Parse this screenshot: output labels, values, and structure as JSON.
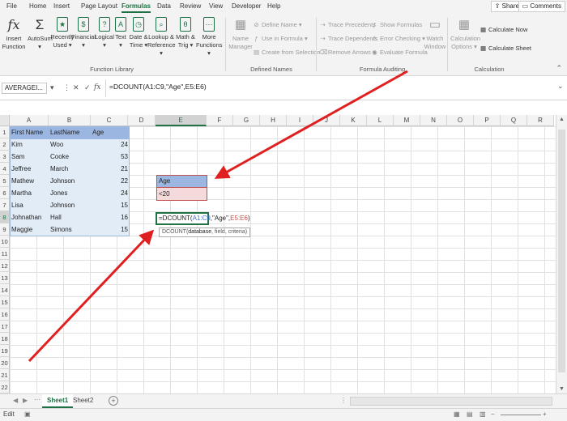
{
  "menu": [
    "File",
    "Home",
    "Insert",
    "Page Layout",
    "Formulas",
    "Data",
    "Review",
    "View",
    "Developer",
    "Help"
  ],
  "share_label": "Share",
  "comments_label": "Comments",
  "ribbon": {
    "insert_function": [
      "Insert",
      "Function"
    ],
    "autosum": [
      "AutoSum",
      "▾"
    ],
    "recently_used": [
      "Recently",
      "Used ▾"
    ],
    "financial": [
      "Financial",
      "▾"
    ],
    "logical": [
      "Logical",
      "▾"
    ],
    "text": [
      "Text",
      "▾"
    ],
    "date_time": [
      "Date &",
      "Time ▾"
    ],
    "lookup_reference": [
      "Lookup &",
      "Reference ▾"
    ],
    "math_trig": [
      "Math &",
      "Trig ▾"
    ],
    "more_functions": [
      "More",
      "Functions ▾"
    ],
    "name_manager": [
      "Name",
      "Manager"
    ],
    "define_name": "Define Name",
    "use_in_formula": "Use in Formula",
    "create_from_selection": "Create from Selection",
    "trace_precedents": "Trace Precedents",
    "trace_dependents": "Trace Dependents",
    "remove_arrows": "Remove Arrows",
    "show_formulas": "Show Formulas",
    "error_checking": "Error Checking",
    "evaluate_formula": "Evaluate Formula",
    "watch_window": [
      "Watch",
      "Window"
    ],
    "calculation_options": [
      "Calculation",
      "Options ▾"
    ],
    "calculate_now": "Calculate Now",
    "calculate_sheet": "Calculate Sheet",
    "groups": [
      "Function Library",
      "Defined Names",
      "Formula Auditing",
      "Calculation"
    ]
  },
  "formula_bar": {
    "name_box": "AVERAGEI...",
    "formula": "=DCOUNT(A1:C9,\"Age\",E5:E6)"
  },
  "columns": [
    "A",
    "B",
    "C",
    "D",
    "E",
    "F",
    "G",
    "H",
    "I",
    "J",
    "K",
    "L",
    "M",
    "N",
    "O",
    "P",
    "Q",
    "R"
  ],
  "rows": [
    "1",
    "2",
    "3",
    "4",
    "5",
    "6",
    "7",
    "8",
    "9",
    "10",
    "11",
    "12",
    "13",
    "14",
    "15",
    "16",
    "17",
    "18",
    "19",
    "20",
    "21",
    "22"
  ],
  "table": {
    "headers": [
      "First Name",
      "LastName",
      "Age"
    ],
    "rows": [
      [
        "Kim",
        "Woo",
        "24"
      ],
      [
        "Sam",
        "Cooke",
        "53"
      ],
      [
        "Jeffree",
        "March",
        "21"
      ],
      [
        "Mathew",
        "Johnson",
        "22"
      ],
      [
        "Martha",
        "Jones",
        "24"
      ],
      [
        "Lisa",
        "Johnson",
        "15"
      ],
      [
        "Johnathan",
        "Hall",
        "16"
      ],
      [
        "Maggie",
        "Simons",
        "15"
      ]
    ]
  },
  "criteria": {
    "header": "Age",
    "value": "<20"
  },
  "active_cell": {
    "prefix": "=DCOUNT(",
    "range": "A1:C9",
    "middle": ",\"Age\",",
    "crit": "E5:E6",
    "suffix": ")"
  },
  "tooltip": {
    "fn": "DCOUNT(",
    "arg1": "database",
    "rest": ", field, criteria)"
  },
  "sheets": [
    "Sheet1",
    "Sheet2"
  ],
  "status": "Edit",
  "colors": {
    "accent": "#217346",
    "arrow": "#e02020",
    "table_header": "#9bb7e1",
    "criteria_bg": "#f4dada"
  }
}
